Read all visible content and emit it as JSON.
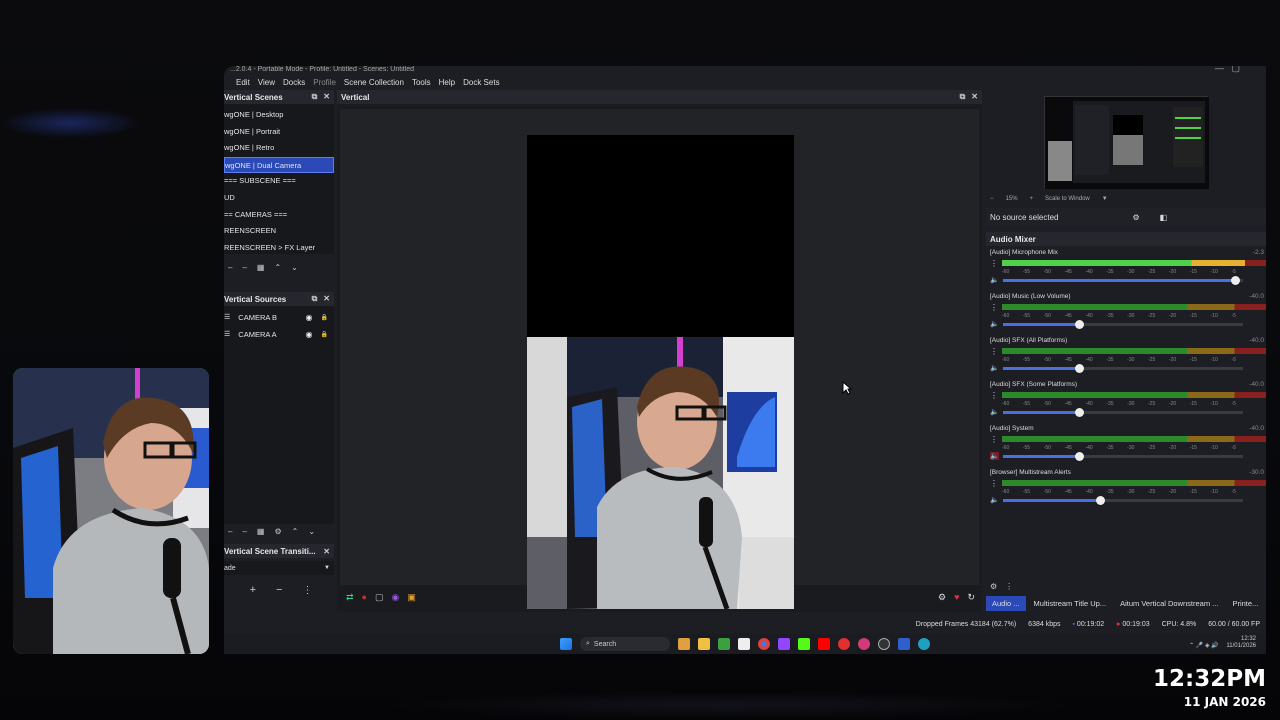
{
  "window": {
    "title": "...2.0.4 - Portable Mode - Profile: Untitled - Scenes: Untitled",
    "menu": [
      "Edit",
      "View",
      "Docks",
      "Profile",
      "Scene Collection",
      "Tools",
      "Help",
      "Dock Sets"
    ]
  },
  "scenes_dock": {
    "title": "Vertical Scenes",
    "items": [
      "wgONE | Desktop",
      "wgONE | Portrait",
      "wgONE | Retro",
      "wgONE | Dual Camera",
      "=== SUBSCENE ===",
      "UD",
      "== CAMERAS ===",
      "REENSCREEN",
      "REENSCREEN > FX Layer"
    ],
    "selected_index": 3
  },
  "sources_dock": {
    "title": "Vertical Sources",
    "items": [
      "CAMERA B",
      "CAMERA A"
    ]
  },
  "transitions_dock": {
    "title": "Vertical Scene Transiti...",
    "selected": "ade"
  },
  "preview": {
    "title": "Vertical"
  },
  "right": {
    "zoom": "15%",
    "scale_mode": "Scale to Window",
    "no_source": "No source selected"
  },
  "mixer": {
    "title": "Audio Mixer",
    "tick_labels": [
      "-60",
      "-55",
      "-50",
      "-45",
      "-40",
      "-35",
      "-30",
      "-25",
      "-20",
      "-15",
      "-10",
      "-5"
    ],
    "channels": [
      {
        "name": "[Audio] Microphone Mix",
        "db": "-2.3",
        "level": 0.92,
        "volume": 0.97,
        "muted": false
      },
      {
        "name": "[Audio] Music (Low Volume)",
        "db": "-40.0",
        "level": 0.0,
        "volume": 0.32,
        "muted": false
      },
      {
        "name": "[Audio] SFX (All Platforms)",
        "db": "-40.0",
        "level": 0.0,
        "volume": 0.32,
        "muted": false
      },
      {
        "name": "[Audio] SFX (Some Platforms)",
        "db": "-40.0",
        "level": 0.0,
        "volume": 0.32,
        "muted": false
      },
      {
        "name": "[Audio] System",
        "db": "-40.0",
        "level": 0.0,
        "volume": 0.32,
        "muted": true
      },
      {
        "name": "[Browser] Multistream Alerts",
        "db": "-30.0",
        "level": 0.0,
        "volume": 0.41,
        "muted": false
      }
    ]
  },
  "dock_tabs": [
    "Audio ...",
    "Multistream Title Up...",
    "Aitum Vertical Downstream ...",
    "Printe..."
  ],
  "status": {
    "dropped": "Dropped Frames 43184 (62.7%)",
    "bitrate": "6384 kbps",
    "rec_time": "00:19:02",
    "stream_time": "00:19:03",
    "cpu": "CPU: 4.8%",
    "fps": "60.00 / 60.00 FP"
  },
  "taskbar": {
    "search": "Search",
    "time": "12:32",
    "date": "11/01/2026"
  },
  "overlay": {
    "clock": "12:32PM",
    "date": "11 JAN 2026"
  },
  "colors": {
    "accent": "#2b4ab8",
    "meter_green": "#4fd14a",
    "meter_yellow": "#e6b030",
    "meter_red": "#c02a2a"
  }
}
